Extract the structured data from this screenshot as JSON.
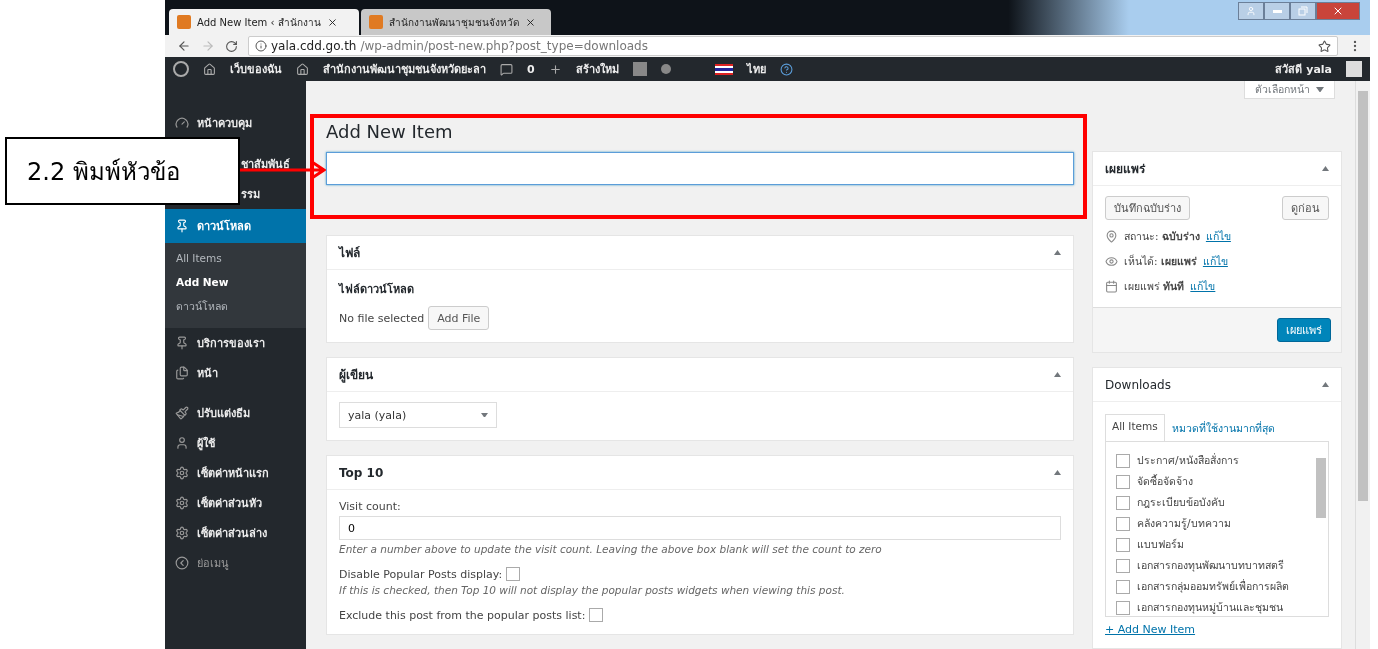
{
  "browser": {
    "tabs": [
      {
        "title": "Add New Item ‹ สำนักงาน",
        "selected": true
      },
      {
        "title": "สำนักงานพัฒนาชุมชนจังหวัด",
        "selected": false
      }
    ],
    "url_host": "yala.cdd.go.th",
    "url_path": "/wp-admin/post-new.php?post_type=downloads"
  },
  "admin_bar": {
    "items": [
      "เว็บของฉัน",
      "สำนักงานพัฒนาชุมชนจังหวัดยะลา",
      "0",
      "สร้างใหม่",
      "ไทย"
    ],
    "greeting": "สวัสดี yala"
  },
  "sidebar": {
    "items": [
      {
        "label": "หน้าควบคุม",
        "kind": "menu",
        "selected": false
      },
      {
        "label": "ชาสัมพันธ์",
        "kind": "cut",
        "selected": false
      },
      {
        "label": "รรม",
        "kind": "cut",
        "selected": false
      },
      {
        "label": "ดาวน์โหลด",
        "kind": "menu",
        "selected": true,
        "children": [
          {
            "label": "All Items",
            "selected": false
          },
          {
            "label": "Add New",
            "selected": true
          },
          {
            "label": "ดาวน์โหลด",
            "selected": false
          }
        ]
      },
      {
        "label": "บริการของเรา",
        "kind": "menu",
        "selected": false
      },
      {
        "label": "หน้า",
        "kind": "menu",
        "selected": false
      },
      {
        "label": "ปรับแต่งธีม",
        "kind": "menu",
        "selected": false
      },
      {
        "label": "ผู้ใช้",
        "kind": "menu",
        "selected": false
      },
      {
        "label": "เซ็ตค่าหน้าแรก",
        "kind": "menu",
        "selected": false
      },
      {
        "label": "เซ็ตค่าส่วนหัว",
        "kind": "menu",
        "selected": false
      },
      {
        "label": "เซ็ตค่าส่วนล่าง",
        "kind": "menu",
        "selected": false
      },
      {
        "label": "ย่อเมนู",
        "kind": "collapse",
        "selected": false
      }
    ]
  },
  "screen_options": "ตัวเลือกหน้า",
  "page_title": "Add New Item",
  "annotation": "2.2 พิมพ์หัวข้อ",
  "files_box": {
    "title": "ไฟล์",
    "label": "ไฟล์ดาวน์โหลด",
    "status": "No file selected",
    "button": "Add File"
  },
  "author_box": {
    "title": "ผู้เขียน",
    "value": "yala (yala)"
  },
  "top10_box": {
    "title": "Top 10",
    "visit_label": "Visit count:",
    "visit_value": "0",
    "visit_help": "Enter a number above to update the visit count. Leaving the above box blank will set the count to zero",
    "options": [
      {
        "label": "Disable Popular Posts display:",
        "checked": false,
        "help": "If this is checked, then Top 10 will not display the popular posts widgets when viewing this post."
      },
      {
        "label": "Exclude this post from the popular posts list:",
        "checked": false
      }
    ]
  },
  "publish_box": {
    "title": "เผยแพร่",
    "save_button": "บันทึกฉบับร่าง",
    "preview_button": "ดูก่อน",
    "rows": [
      {
        "label": "สถานะ:",
        "value": "ฉบับร่าง",
        "link": "แก้ไข"
      },
      {
        "label": "เห็นได้:",
        "value": "เผยแพร่",
        "link": "แก้ไข"
      },
      {
        "label": "เผยแพร่",
        "value": "ทันที",
        "link": "แก้ไข"
      }
    ],
    "publish_button": "เผยแพร่"
  },
  "downloads_box": {
    "title": "Downloads",
    "tabs": [
      {
        "label": "All Items",
        "selected": true
      },
      {
        "label": "หมวดที่ใช้งานมากที่สุด",
        "selected": false
      }
    ],
    "categories": [
      {
        "label": "ประกาศ/หนังสือสั่งการ",
        "checked": false
      },
      {
        "label": "จัดซื้อจัดจ้าง",
        "checked": false
      },
      {
        "label": "กฎระเบียบข้อบังคับ",
        "checked": false
      },
      {
        "label": "คลังความรู้/บทความ",
        "checked": false
      },
      {
        "label": "แบบฟอร์ม",
        "checked": false
      },
      {
        "label": "เอกสารกองทุนพัฒนาบทบาทสตรี",
        "checked": false
      },
      {
        "label": "เอกสารกลุ่มออมทรัพย์เพื่อการผลิต",
        "checked": false
      },
      {
        "label": "เอกสารกองทุนหมู่บ้านและชุมชน",
        "checked": false
      }
    ],
    "add_link": "+ Add New Item"
  }
}
